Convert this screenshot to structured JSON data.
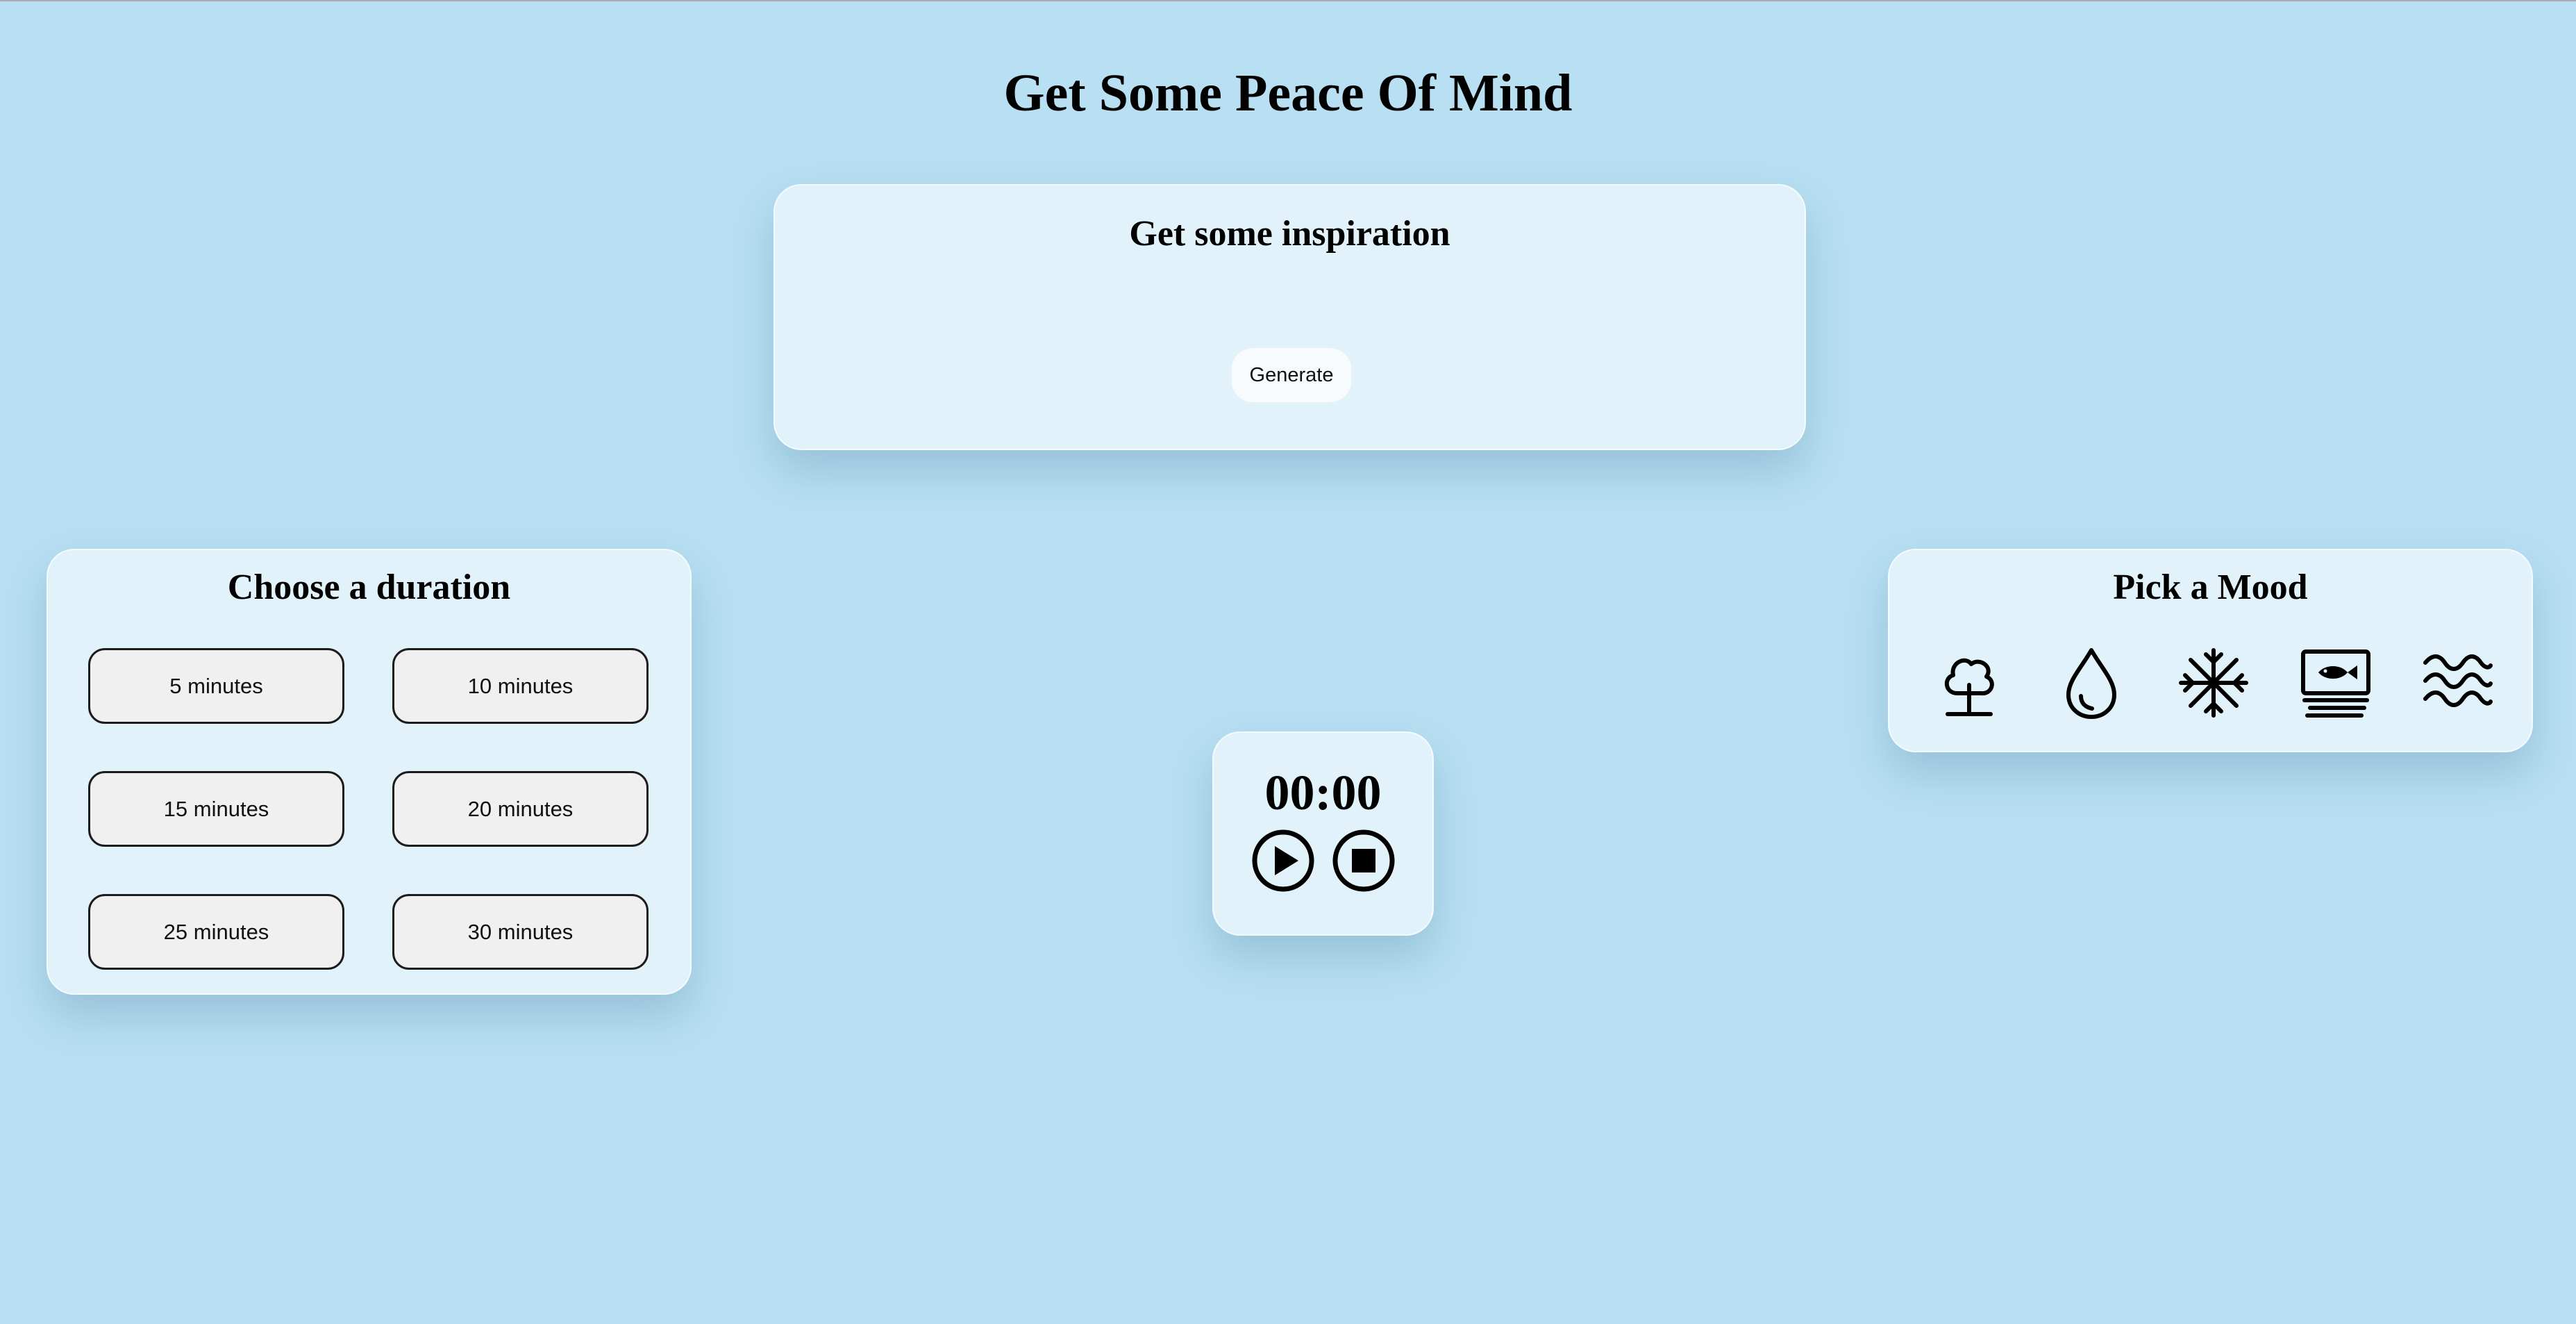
{
  "page": {
    "title": "Get Some Peace Of Mind",
    "background": "#b8dff2",
    "card_background": "#e2f2fa"
  },
  "inspiration": {
    "title": "Get some inspiration",
    "generate_label": "Generate"
  },
  "duration": {
    "title": "Choose a duration",
    "options": [
      "5 minutes",
      "10 minutes",
      "15 minutes",
      "20 minutes",
      "25 minutes",
      "30 minutes"
    ]
  },
  "timer": {
    "display": "00:00",
    "controls": [
      {
        "name": "play-icon"
      },
      {
        "name": "stop-icon"
      }
    ]
  },
  "mood": {
    "title": "Pick a Mood",
    "icons": [
      "tree-icon",
      "water-drop-icon",
      "snowflake-icon",
      "aquarium-icon",
      "waves-icon"
    ]
  }
}
